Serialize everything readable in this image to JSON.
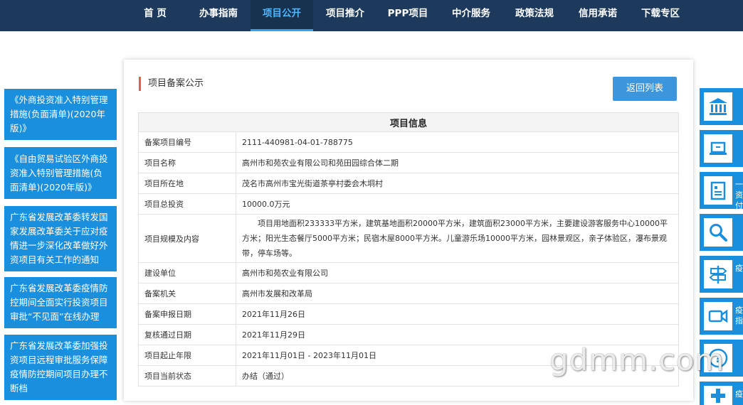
{
  "nav": {
    "items": [
      "首 页",
      "办事指南",
      "项目公开",
      "项目推介",
      "PPP项目",
      "中介服务",
      "政策法规",
      "信用承诺",
      "下载专区"
    ],
    "active": "项目公开"
  },
  "sidebar": {
    "items": [
      "《外商投资准入特别管理措施(负面清单)(2020年版)》",
      "《自由贸易试验区外商投资准入特别管理措施(负面清单)(2020年版)》",
      "广东省发展改革委转发国家发展改革委关于应对疫情进一步深化改革做好外资项目有关工作的通知",
      "广东省发展改革委疫情防控期间全面实行投资项目审批“不见面”在线办理",
      "广东省发展改革委加强投资项目远程审批服务保障疫情防控期间项目办理不断档"
    ]
  },
  "panel": {
    "title": "项目备案公示",
    "back_button": "返回列表",
    "table_header": "项目信息",
    "rows": [
      {
        "label": "备案项目编号",
        "value": "2111-440981-04-01-788775"
      },
      {
        "label": "项目名称",
        "value": "高州市和苑农业有限公司和苑田园综合体二期"
      },
      {
        "label": "项目所在地",
        "value": "茂名市高州市宝光街道茶亭村委会木垌村"
      },
      {
        "label": "项目总投资",
        "value": "10000.0万元"
      },
      {
        "label": "项目规模及内容",
        "value": "项目用地面积233333平方米，建筑基地面积20000平方米，建筑面积23000平方米，主要建设游客服务中心10000平方米；阳光生态餐厅5000平方米；民宿木屋8000平方米。儿童游乐场10000平方米，园林景观区，亲子体验区，瀑布景观带，停车场等。"
      },
      {
        "label": "建设单位",
        "value": "高州市和苑农业有限公司"
      },
      {
        "label": "备案机关",
        "value": "高州市发展和改革局"
      },
      {
        "label": "备案申报日期",
        "value": "2021年11月26日"
      },
      {
        "label": "复核通过日期",
        "value": "2021年11月29日"
      },
      {
        "label": "项目起止年限",
        "value": "2021年11月01日 - 2023年11月01日"
      },
      {
        "label": "项目当前状态",
        "value": "办结（通过）"
      }
    ]
  },
  "right_sidebar": {
    "items": [
      {
        "icon": "bank-icon",
        "label": ""
      },
      {
        "icon": "laptop-icon",
        "label": ""
      },
      {
        "icon": "document-list-icon",
        "label": "一 资 付"
      },
      {
        "icon": "search-icon",
        "label": ""
      },
      {
        "icon": "signpost-icon",
        "label": "疫"
      },
      {
        "icon": "video-camera-icon",
        "label": "疫 指"
      },
      {
        "icon": "help-icon",
        "label": ""
      },
      {
        "icon": "medical-icon",
        "label": "疫"
      }
    ]
  },
  "watermark": "gdmm.com",
  "colors": {
    "nav_bg": "#1d3a5c",
    "nav_active": "#4db8ff",
    "accent_blue": "#1a8fde",
    "button_blue": "#3d96dc",
    "title_bar": "#e0614a"
  }
}
